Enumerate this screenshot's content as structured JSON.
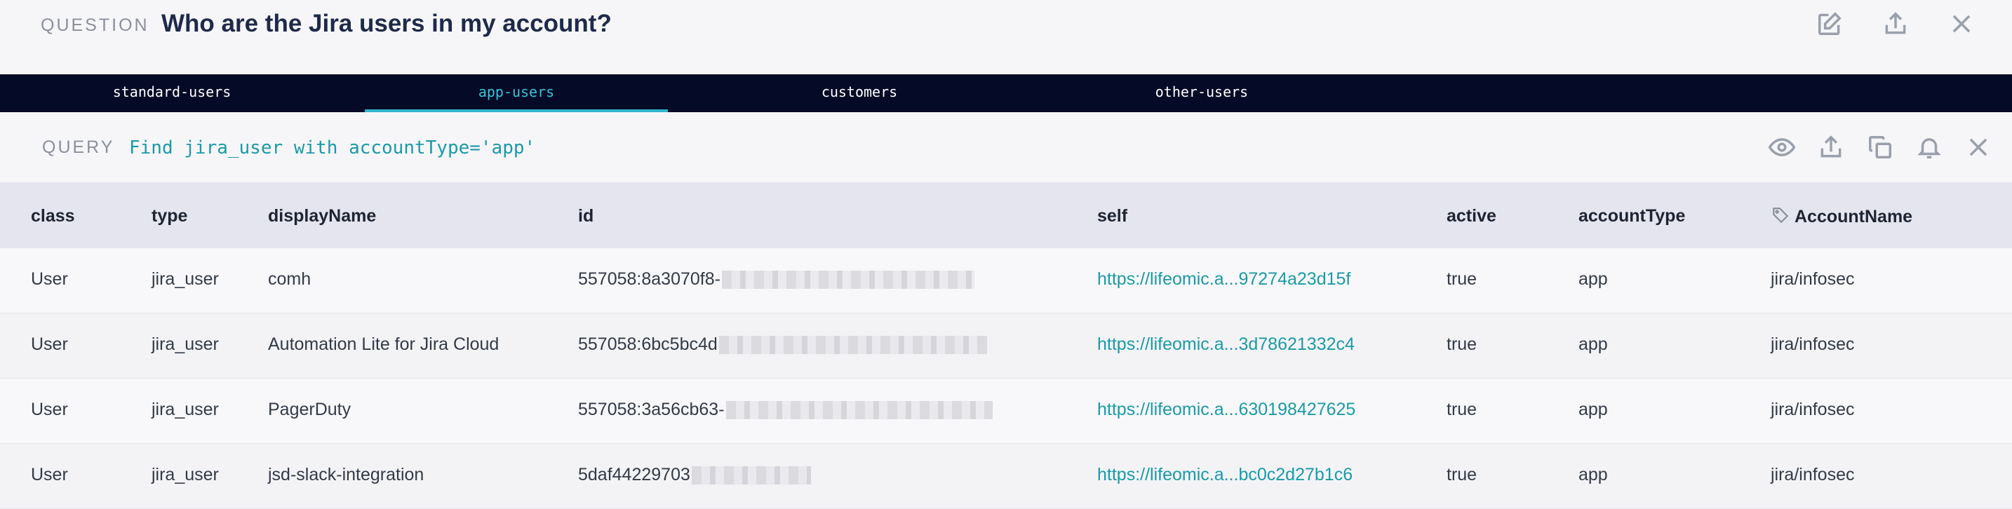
{
  "question": {
    "label": "QUESTION",
    "title": "Who are the Jira users in my account?"
  },
  "icons": {
    "edit": "edit-icon",
    "share": "share-icon",
    "close": "close-icon",
    "eye": "eye-icon",
    "export": "export-icon",
    "copy": "copy-icon",
    "bell": "bell-icon",
    "tag": "tag-icon"
  },
  "tabs": [
    {
      "label": "standard-users"
    },
    {
      "label": "app-users"
    },
    {
      "label": "customers"
    },
    {
      "label": "other-users"
    }
  ],
  "query": {
    "label": "QUERY",
    "text": "Find jira_user with accountType='app'"
  },
  "table": {
    "columns": [
      "class",
      "type",
      "displayName",
      "id",
      "self",
      "active",
      "accountType",
      "AccountName"
    ],
    "rows": [
      {
        "class": "User",
        "type": "jira_user",
        "displayName": "comh",
        "id": "557058:8a3070f8-",
        "self": "https://lifeomic.a...97274a23d15f",
        "active": "true",
        "accountType": "app",
        "AccountName": "jira/infosec"
      },
      {
        "class": "User",
        "type": "jira_user",
        "displayName": "Automation Lite for Jira Cloud",
        "id": "557058:6bc5bc4d",
        "self": "https://lifeomic.a...3d78621332c4",
        "active": "true",
        "accountType": "app",
        "AccountName": "jira/infosec"
      },
      {
        "class": "User",
        "type": "jira_user",
        "displayName": "PagerDuty",
        "id": "557058:3a56cb63-",
        "self": "https://lifeomic.a...630198427625",
        "active": "true",
        "accountType": "app",
        "AccountName": "jira/infosec"
      },
      {
        "class": "User",
        "type": "jira_user",
        "displayName": "jsd-slack-integration",
        "id": "5daf44229703",
        "self": "https://lifeomic.a...bc0c2d27b1c6",
        "active": "true",
        "accountType": "app",
        "AccountName": "jira/infosec"
      }
    ]
  },
  "colors": {
    "accent": "#1a9aa8",
    "tabs_bg": "#050a26",
    "header_bg": "#e4e5ee"
  }
}
